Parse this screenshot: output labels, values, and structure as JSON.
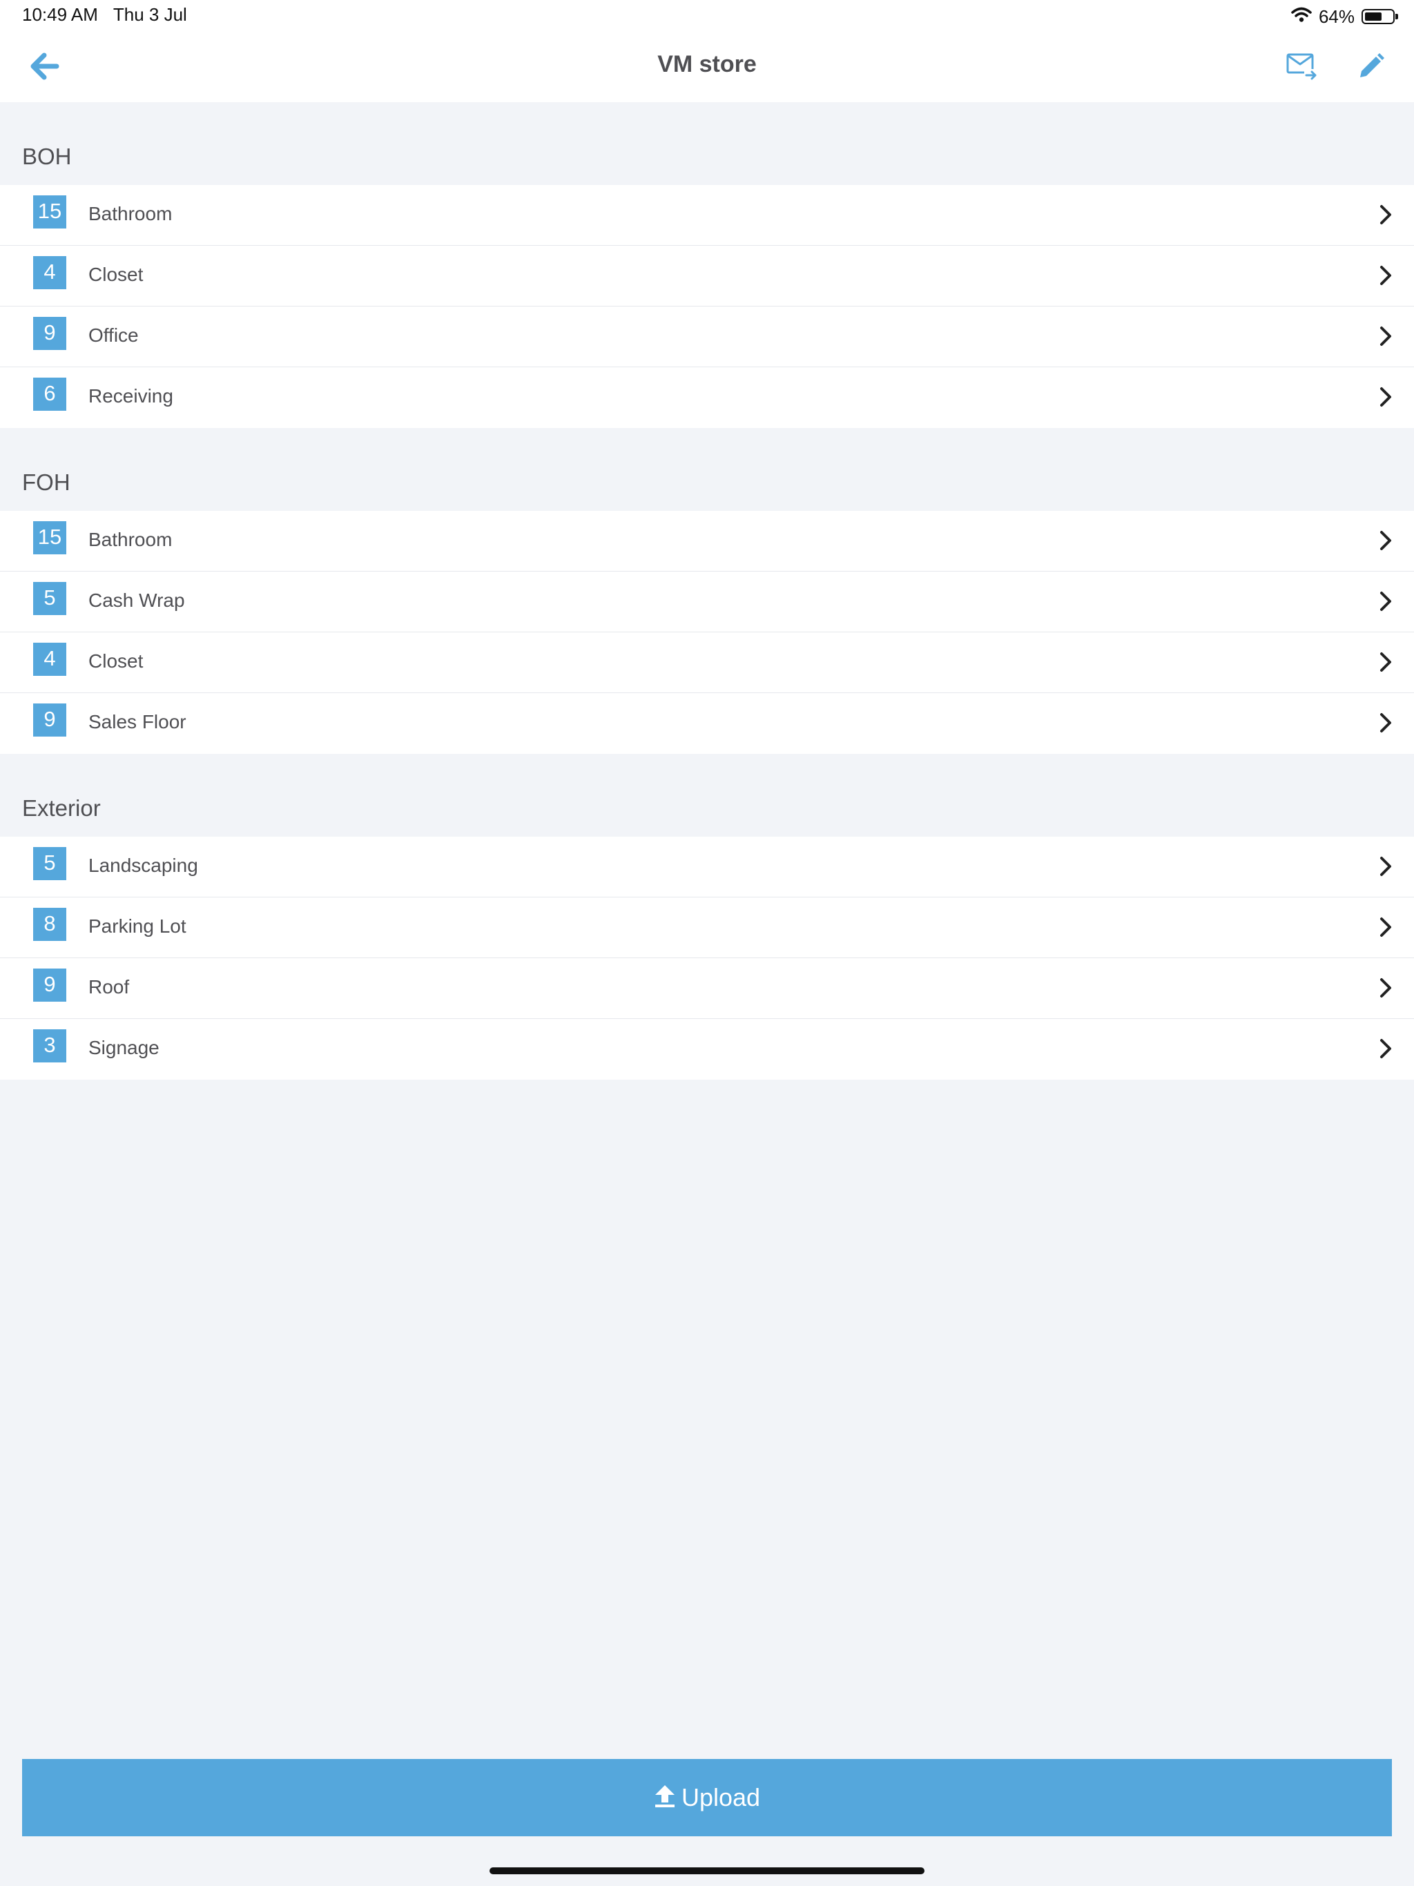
{
  "status_bar": {
    "time": "10:49 AM",
    "date": "Thu 3 Jul",
    "battery_text": "64%",
    "battery_level": 0.64
  },
  "nav": {
    "title": "VM store",
    "back_icon": "arrow-left-icon",
    "mail_icon": "mail-forward-icon",
    "edit_icon": "pencil-icon"
  },
  "colors": {
    "accent": "#55a7dc",
    "background": "#f2f4f8",
    "text": "#4f4f53"
  },
  "sections": [
    {
      "title": "BOH",
      "items": [
        {
          "count": "15",
          "label": "Bathroom"
        },
        {
          "count": "4",
          "label": "Closet"
        },
        {
          "count": "9",
          "label": "Office"
        },
        {
          "count": "6",
          "label": "Receiving"
        }
      ]
    },
    {
      "title": "FOH",
      "items": [
        {
          "count": "15",
          "label": "Bathroom"
        },
        {
          "count": "5",
          "label": "Cash Wrap"
        },
        {
          "count": "4",
          "label": "Closet"
        },
        {
          "count": "9",
          "label": "Sales Floor"
        }
      ]
    },
    {
      "title": "Exterior",
      "items": [
        {
          "count": "5",
          "label": "Landscaping"
        },
        {
          "count": "8",
          "label": "Parking Lot"
        },
        {
          "count": "9",
          "label": "Roof"
        },
        {
          "count": "3",
          "label": "Signage"
        }
      ]
    }
  ],
  "upload": {
    "label": "Upload",
    "icon": "upload-icon"
  }
}
